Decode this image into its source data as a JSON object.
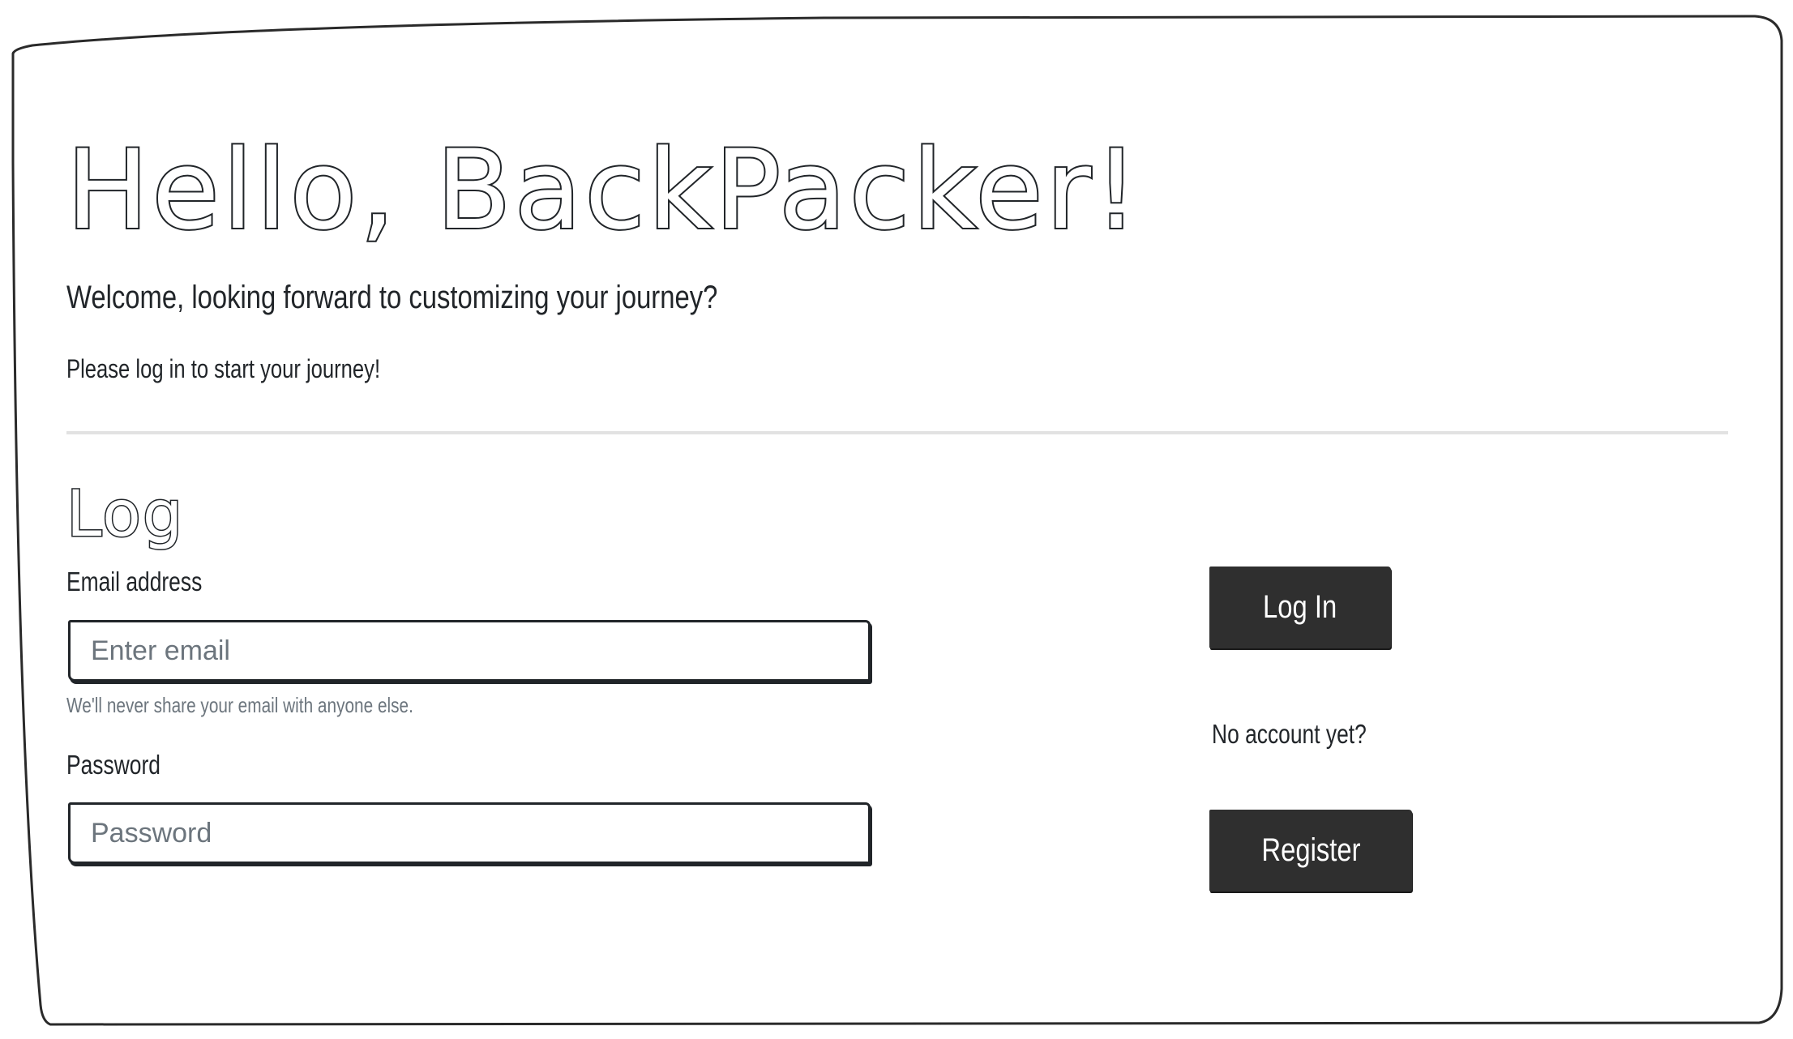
{
  "hero": {
    "title": "Hello, BackPacker!",
    "lead": "Welcome, looking forward to customizing your journey?",
    "prompt": "Please log in to start your journey!"
  },
  "login_form": {
    "section_title": "Log",
    "email_label": "Email address",
    "email_placeholder": "Enter email",
    "email_value": "",
    "email_help": "We'll never share your email with anyone else.",
    "password_label": "Password",
    "password_placeholder": "Password",
    "password_value": ""
  },
  "actions": {
    "login_label": "Log In",
    "no_account_text": "No account yet?",
    "register_label": "Register"
  },
  "colors": {
    "text": "#212529",
    "muted": "#6c757d",
    "button_bg": "#2f2f2f",
    "button_text": "#ffffff",
    "divider": "#e2e2e2"
  }
}
